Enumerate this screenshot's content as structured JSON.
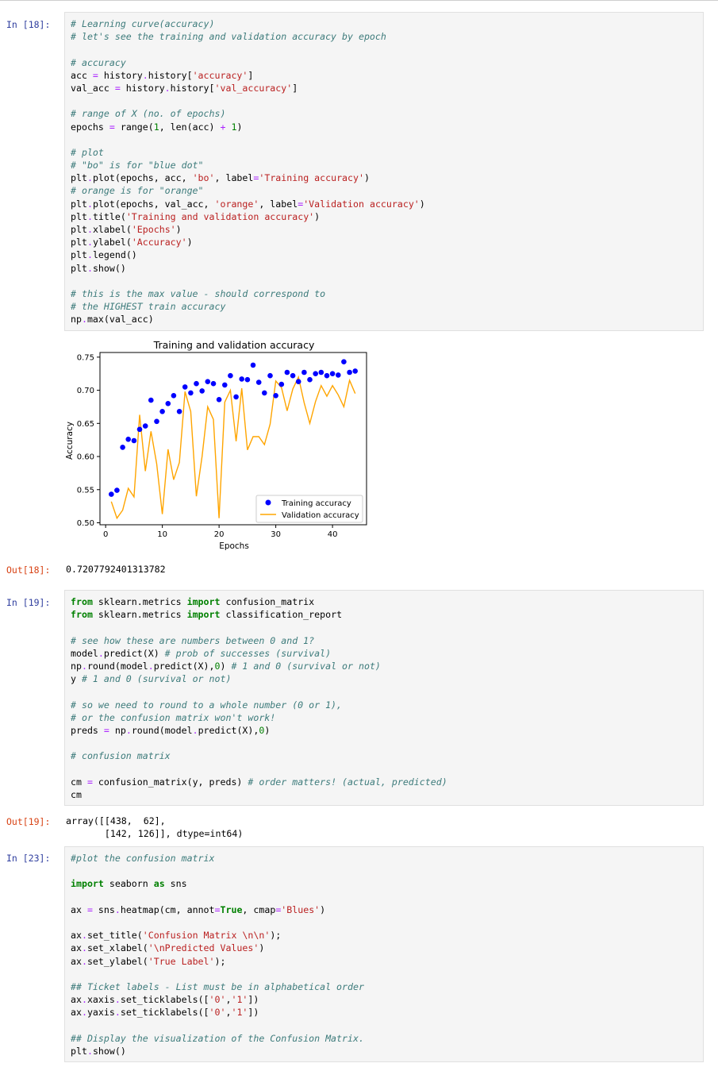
{
  "cells": [
    {
      "prompt": "In [18]:",
      "lines": [
        [
          [
            "c",
            "# Learning curve(accuracy)"
          ]
        ],
        [
          [
            "c",
            "# let's see the training and validation accuracy by epoch"
          ]
        ],
        [],
        [
          [
            "c",
            "# accuracy"
          ]
        ],
        [
          [
            "t",
            "acc "
          ],
          [
            "o",
            "="
          ],
          [
            "t",
            " history"
          ],
          [
            "o",
            "."
          ],
          [
            "t",
            "history["
          ],
          [
            "s",
            "'accuracy'"
          ],
          [
            "t",
            "]"
          ]
        ],
        [
          [
            "t",
            "val_acc "
          ],
          [
            "o",
            "="
          ],
          [
            "t",
            " history"
          ],
          [
            "o",
            "."
          ],
          [
            "t",
            "history["
          ],
          [
            "s",
            "'val_accuracy'"
          ],
          [
            "t",
            "]"
          ]
        ],
        [],
        [
          [
            "c",
            "# range of X (no. of epochs)"
          ]
        ],
        [
          [
            "t",
            "epochs "
          ],
          [
            "o",
            "="
          ],
          [
            "t",
            " range("
          ],
          [
            "n",
            "1"
          ],
          [
            "t",
            ", len(acc) "
          ],
          [
            "o",
            "+"
          ],
          [
            "t",
            " "
          ],
          [
            "n",
            "1"
          ],
          [
            "t",
            ")"
          ]
        ],
        [],
        [
          [
            "c",
            "# plot"
          ]
        ],
        [
          [
            "c",
            "# \"bo\" is for \"blue dot\""
          ]
        ],
        [
          [
            "t",
            "plt"
          ],
          [
            "o",
            "."
          ],
          [
            "t",
            "plot(epochs, acc, "
          ],
          [
            "s",
            "'bo'"
          ],
          [
            "t",
            ", label"
          ],
          [
            "o",
            "="
          ],
          [
            "s",
            "'Training accuracy'"
          ],
          [
            "t",
            ")"
          ]
        ],
        [
          [
            "c",
            "# orange is for \"orange\""
          ]
        ],
        [
          [
            "t",
            "plt"
          ],
          [
            "o",
            "."
          ],
          [
            "t",
            "plot(epochs, val_acc, "
          ],
          [
            "s",
            "'orange'"
          ],
          [
            "t",
            ", label"
          ],
          [
            "o",
            "="
          ],
          [
            "s",
            "'Validation accuracy'"
          ],
          [
            "t",
            ")"
          ]
        ],
        [
          [
            "t",
            "plt"
          ],
          [
            "o",
            "."
          ],
          [
            "t",
            "title("
          ],
          [
            "s",
            "'Training and validation accuracy'"
          ],
          [
            "t",
            ")"
          ]
        ],
        [
          [
            "t",
            "plt"
          ],
          [
            "o",
            "."
          ],
          [
            "t",
            "xlabel("
          ],
          [
            "s",
            "'Epochs'"
          ],
          [
            "t",
            ")"
          ]
        ],
        [
          [
            "t",
            "plt"
          ],
          [
            "o",
            "."
          ],
          [
            "t",
            "ylabel("
          ],
          [
            "s",
            "'Accuracy'"
          ],
          [
            "t",
            ")"
          ]
        ],
        [
          [
            "t",
            "plt"
          ],
          [
            "o",
            "."
          ],
          [
            "t",
            "legend()"
          ]
        ],
        [
          [
            "t",
            "plt"
          ],
          [
            "o",
            "."
          ],
          [
            "t",
            "show()"
          ]
        ],
        [],
        [
          [
            "c",
            "# this is the max value - should correspond to"
          ]
        ],
        [
          [
            "c",
            "# the HIGHEST train accuracy"
          ]
        ],
        [
          [
            "t",
            "np"
          ],
          [
            "o",
            "."
          ],
          [
            "t",
            "max(val_acc)"
          ]
        ]
      ]
    },
    {
      "prompt": "In [19]:",
      "lines": [
        [
          [
            "k",
            "from"
          ],
          [
            "t",
            " sklearn.metrics "
          ],
          [
            "k",
            "import"
          ],
          [
            "t",
            " confusion_matrix"
          ]
        ],
        [
          [
            "k",
            "from"
          ],
          [
            "t",
            " sklearn.metrics "
          ],
          [
            "k",
            "import"
          ],
          [
            "t",
            " classification_report"
          ]
        ],
        [],
        [
          [
            "c",
            "# see how these are numbers between 0 and 1?"
          ]
        ],
        [
          [
            "t",
            "model"
          ],
          [
            "o",
            "."
          ],
          [
            "t",
            "predict(X) "
          ],
          [
            "c",
            "# prob of successes (survival)"
          ]
        ],
        [
          [
            "t",
            "np"
          ],
          [
            "o",
            "."
          ],
          [
            "t",
            "round(model"
          ],
          [
            "o",
            "."
          ],
          [
            "t",
            "predict(X),"
          ],
          [
            "n",
            "0"
          ],
          [
            "t",
            ") "
          ],
          [
            "c",
            "# 1 and 0 (survival or not)"
          ]
        ],
        [
          [
            "t",
            "y "
          ],
          [
            "c",
            "# 1 and 0 (survival or not)"
          ]
        ],
        [],
        [
          [
            "c",
            "# so we need to round to a whole number (0 or 1),"
          ]
        ],
        [
          [
            "c",
            "# or the confusion matrix won't work!"
          ]
        ],
        [
          [
            "t",
            "preds "
          ],
          [
            "o",
            "="
          ],
          [
            "t",
            " np"
          ],
          [
            "o",
            "."
          ],
          [
            "t",
            "round(model"
          ],
          [
            "o",
            "."
          ],
          [
            "t",
            "predict(X),"
          ],
          [
            "n",
            "0"
          ],
          [
            "t",
            ")"
          ]
        ],
        [],
        [
          [
            "c",
            "# confusion matrix"
          ]
        ],
        [],
        [
          [
            "t",
            "cm "
          ],
          [
            "o",
            "="
          ],
          [
            "t",
            " confusion_matrix(y, preds) "
          ],
          [
            "c",
            "# order matters! (actual, predicted)"
          ]
        ],
        [
          [
            "t",
            "cm"
          ]
        ]
      ]
    },
    {
      "prompt": "In [23]:",
      "lines": [
        [
          [
            "c",
            "#plot the confusion matrix"
          ]
        ],
        [],
        [
          [
            "k",
            "import"
          ],
          [
            "t",
            " seaborn "
          ],
          [
            "k",
            "as"
          ],
          [
            "t",
            " sns"
          ]
        ],
        [],
        [
          [
            "t",
            "ax "
          ],
          [
            "o",
            "="
          ],
          [
            "t",
            " sns"
          ],
          [
            "o",
            "."
          ],
          [
            "t",
            "heatmap(cm, annot"
          ],
          [
            "o",
            "="
          ],
          [
            "k",
            "True"
          ],
          [
            "t",
            ", cmap"
          ],
          [
            "o",
            "="
          ],
          [
            "s",
            "'Blues'"
          ],
          [
            "t",
            ")"
          ]
        ],
        [],
        [
          [
            "t",
            "ax"
          ],
          [
            "o",
            "."
          ],
          [
            "t",
            "set_title("
          ],
          [
            "s",
            "'Confusion Matrix \\n\\n'"
          ],
          [
            "t",
            ");"
          ]
        ],
        [
          [
            "t",
            "ax"
          ],
          [
            "o",
            "."
          ],
          [
            "t",
            "set_xlabel("
          ],
          [
            "s",
            "'\\nPredicted Values'"
          ],
          [
            "t",
            ")"
          ]
        ],
        [
          [
            "t",
            "ax"
          ],
          [
            "o",
            "."
          ],
          [
            "t",
            "set_ylabel("
          ],
          [
            "s",
            "'True Label'"
          ],
          [
            "t",
            ");"
          ]
        ],
        [],
        [
          [
            "c",
            "## Ticket labels - List must be in alphabetical order"
          ]
        ],
        [
          [
            "t",
            "ax"
          ],
          [
            "o",
            "."
          ],
          [
            "t",
            "xaxis"
          ],
          [
            "o",
            "."
          ],
          [
            "t",
            "set_ticklabels(["
          ],
          [
            "s",
            "'0'"
          ],
          [
            "t",
            ","
          ],
          [
            "s",
            "'1'"
          ],
          [
            "t",
            "])"
          ]
        ],
        [
          [
            "t",
            "ax"
          ],
          [
            "o",
            "."
          ],
          [
            "t",
            "yaxis"
          ],
          [
            "o",
            "."
          ],
          [
            "t",
            "set_ticklabels(["
          ],
          [
            "s",
            "'0'"
          ],
          [
            "t",
            ","
          ],
          [
            "s",
            "'1'"
          ],
          [
            "t",
            "])"
          ]
        ],
        [],
        [
          [
            "c",
            "## Display the visualization of the Confusion Matrix."
          ]
        ],
        [
          [
            "t",
            "plt"
          ],
          [
            "o",
            "."
          ],
          [
            "t",
            "show()"
          ]
        ]
      ]
    }
  ],
  "outputs": [
    {
      "prompt": "Out[18]:",
      "text": "0.7207792401313782"
    },
    {
      "prompt": "Out[19]:",
      "text": "array([[438,  62],\n       [142, 126]], dtype=int64)"
    }
  ],
  "chart_data": {
    "type": "line",
    "title": "Training and validation accuracy",
    "xlabel": "Epochs",
    "ylabel": "Accuracy",
    "xlim": [
      -1,
      46
    ],
    "ylim": [
      0.497,
      0.757
    ],
    "xticks": [
      0,
      10,
      20,
      30,
      40
    ],
    "yticks": [
      0.5,
      0.55,
      0.6,
      0.65,
      0.7,
      0.75
    ],
    "grid": false,
    "legend_position": "lower-right",
    "series": [
      {
        "name": "Training accuracy",
        "style": "dots",
        "color": "#0000ff",
        "x": [
          1,
          2,
          3,
          4,
          5,
          6,
          7,
          8,
          9,
          10,
          11,
          12,
          13,
          14,
          15,
          16,
          17,
          18,
          19,
          20,
          21,
          22,
          23,
          24,
          25,
          26,
          27,
          28,
          29,
          30,
          31,
          32,
          33,
          34,
          35,
          36,
          37,
          38,
          39,
          40,
          41,
          42,
          43,
          44
        ],
        "y": [
          0.543,
          0.549,
          0.614,
          0.626,
          0.624,
          0.641,
          0.646,
          0.685,
          0.653,
          0.668,
          0.68,
          0.692,
          0.668,
          0.705,
          0.696,
          0.71,
          0.699,
          0.713,
          0.71,
          0.686,
          0.708,
          0.722,
          0.69,
          0.717,
          0.716,
          0.738,
          0.712,
          0.696,
          0.722,
          0.692,
          0.709,
          0.727,
          0.722,
          0.713,
          0.727,
          0.716,
          0.725,
          0.727,
          0.722,
          0.725,
          0.723,
          0.743,
          0.727,
          0.729
        ]
      },
      {
        "name": "Validation accuracy",
        "style": "line",
        "color": "#ffa500",
        "x": [
          1,
          2,
          3,
          4,
          5,
          6,
          7,
          8,
          9,
          10,
          11,
          12,
          13,
          14,
          15,
          16,
          17,
          18,
          19,
          20,
          21,
          22,
          23,
          24,
          25,
          26,
          27,
          28,
          29,
          30,
          31,
          32,
          33,
          34,
          35,
          36,
          37,
          38,
          39,
          40,
          41,
          42,
          43,
          44
        ],
        "y": [
          0.532,
          0.507,
          0.519,
          0.552,
          0.539,
          0.663,
          0.578,
          0.638,
          0.589,
          0.513,
          0.611,
          0.565,
          0.591,
          0.698,
          0.668,
          0.54,
          0.6,
          0.675,
          0.656,
          0.507,
          0.682,
          0.7,
          0.623,
          0.703,
          0.61,
          0.63,
          0.63,
          0.618,
          0.649,
          0.714,
          0.704,
          0.669,
          0.702,
          0.72,
          0.681,
          0.65,
          0.683,
          0.707,
          0.691,
          0.707,
          0.693,
          0.675,
          0.715,
          0.695
        ]
      }
    ]
  }
}
